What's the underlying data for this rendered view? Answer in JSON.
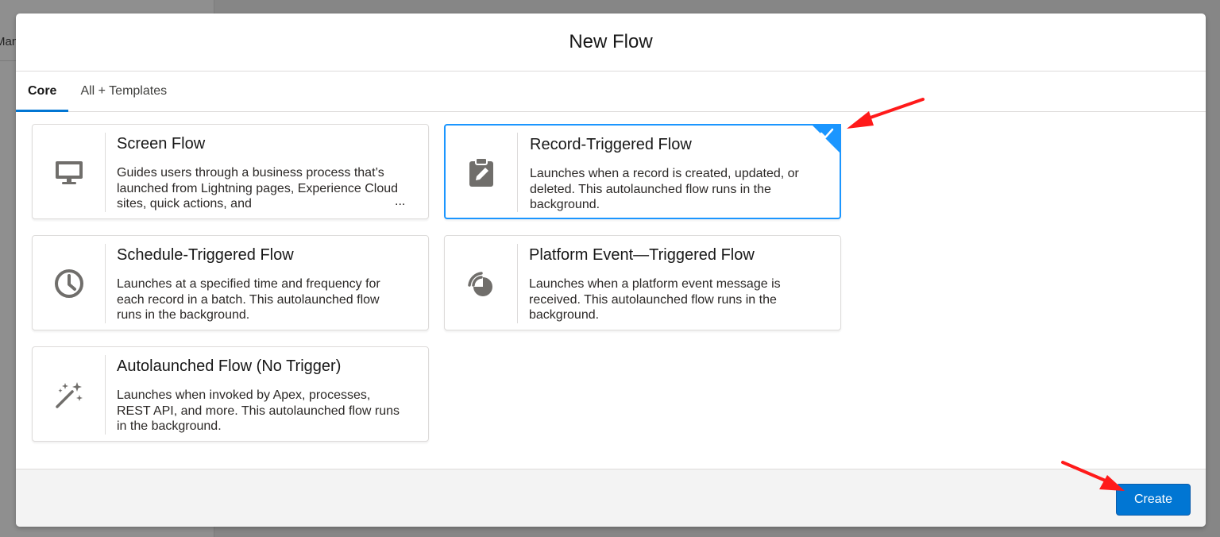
{
  "background": {
    "partial_text": "Man"
  },
  "modal": {
    "title": "New Flow"
  },
  "tabs": [
    {
      "label": "Core",
      "active": true
    },
    {
      "label": "All + Templates",
      "active": false
    }
  ],
  "cards": [
    {
      "title": "Screen Flow",
      "description": "Guides users through a business process that’s launched from Lightning pages, Experience Cloud sites, quick actions, and",
      "ellipsis": "...",
      "icon": "monitor-icon",
      "selected": false
    },
    {
      "title": "Record-Triggered Flow",
      "description": "Launches when a record is created, updated, or deleted. This autolaunched flow runs in the background.",
      "icon": "clipboard-edit-icon",
      "selected": true
    },
    {
      "title": "Schedule-Triggered Flow",
      "description": "Launches at a specified time and frequency for each record in a batch. This autolaunched flow runs in the background.",
      "icon": "clock-icon",
      "selected": false
    },
    {
      "title": "Platform Event—Triggered Flow",
      "description": "Launches when a platform event message is received. This autolaunched flow runs in the background.",
      "icon": "platform-event-icon",
      "selected": false
    },
    {
      "title": "Autolaunched Flow (No Trigger)",
      "description": "Launches when invoked by Apex, processes, REST API, and more. This autolaunched flow runs in the background.",
      "icon": "magic-wand-icon",
      "selected": false
    }
  ],
  "footer": {
    "create_label": "Create"
  },
  "colors": {
    "brand": "#0176d3",
    "selected_border": "#1b96ff",
    "annotation_arrow": "#ff1a1a",
    "icon_gray": "#706e6b"
  }
}
